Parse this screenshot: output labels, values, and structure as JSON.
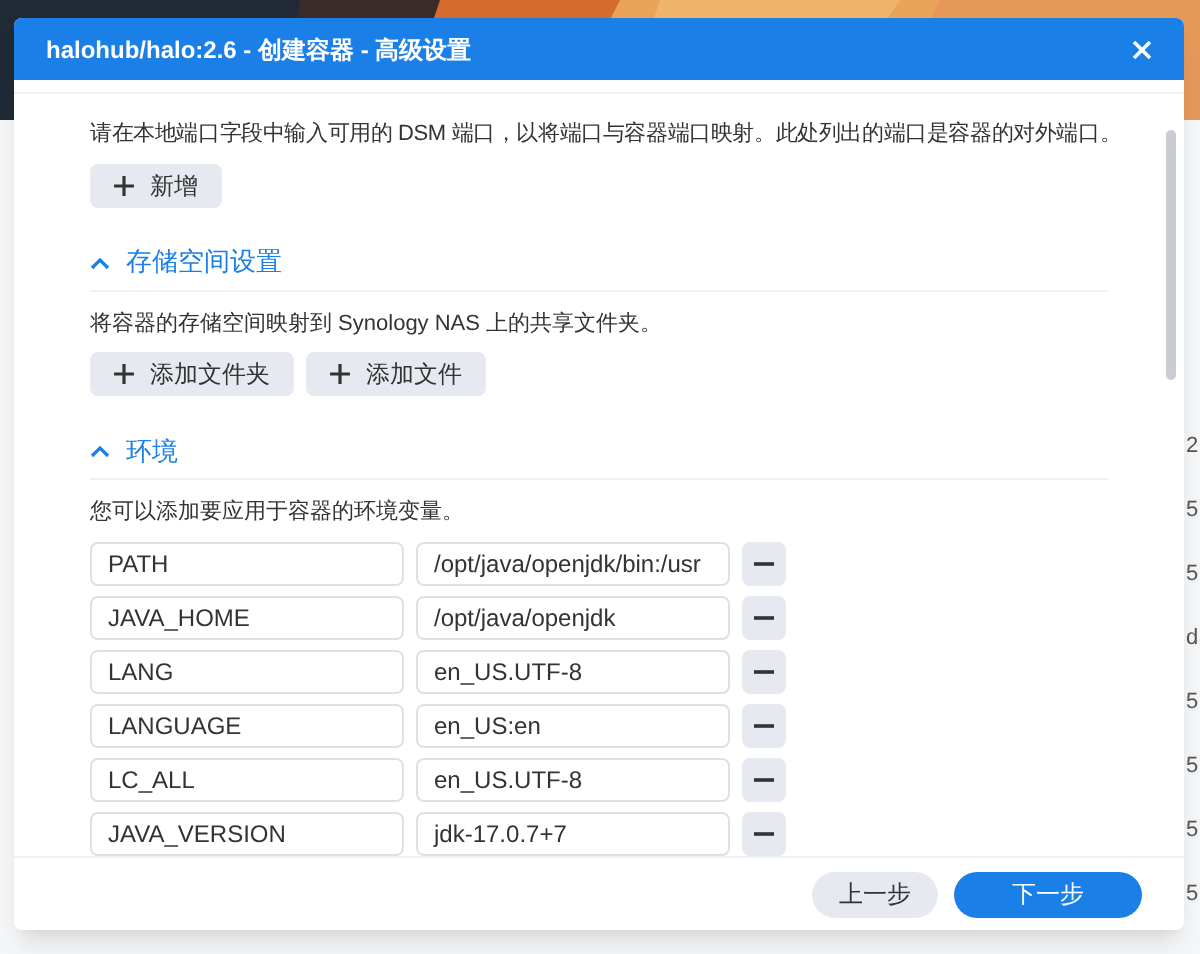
{
  "background": {
    "kind": "picture",
    "side_texts": [
      "2",
      "5",
      "5",
      "d",
      "5",
      "5",
      "5",
      "5"
    ]
  },
  "window": {
    "title": "halohub/halo:2.6 - 创建容器 - 高级设置"
  },
  "ports": {
    "description": "请在本地端口字段中输入可用的 DSM 端口，以将端口与容器端口映射。此处列出的端口是容器的对外端口。",
    "buttons": [
      "新增"
    ]
  },
  "sections": [
    {
      "title": "存储空间设置",
      "expanded": true,
      "description": "将容器的存储空间映射到 Synology NAS 上的共享文件夹。",
      "buttons": [
        "添加文件夹",
        "添加文件"
      ]
    },
    {
      "title": "环境",
      "expanded": true,
      "description": "您可以添加要应用于容器的环境变量。",
      "variables": [
        {
          "name": "PATH",
          "value": "/opt/java/openjdk/bin:/usr"
        },
        {
          "name": "JAVA_HOME",
          "value": "/opt/java/openjdk"
        },
        {
          "name": "LANG",
          "value": "en_US.UTF-8"
        },
        {
          "name": "LANGUAGE",
          "value": "en_US:en"
        },
        {
          "name": "LC_ALL",
          "value": "en_US.UTF-8"
        },
        {
          "name": "JAVA_VERSION",
          "value": "jdk-17.0.7+7"
        }
      ]
    }
  ],
  "footer": {
    "back": "上一步",
    "next": "下一步"
  }
}
